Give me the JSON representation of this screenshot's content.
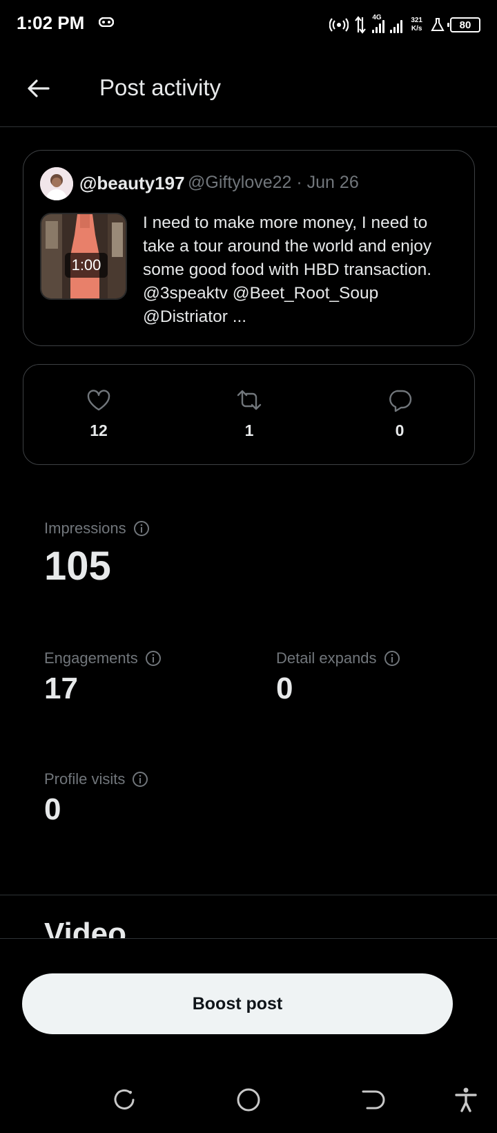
{
  "status_bar": {
    "time": "1:02 PM",
    "network_type": "4G",
    "speed_value": "321",
    "speed_unit": "K/s",
    "battery": "80"
  },
  "header": {
    "title": "Post activity",
    "back_icon": "arrow-left-icon"
  },
  "post": {
    "display_name": "@beauty197",
    "handle_date": "@Giftylove22 · Jun 26",
    "video_duration": "1:00",
    "text": "I need to make more money, I need to take a tour around the world and enjoy some good food with HBD transaction. @3speaktv  @Beet_Root_Soup @Distriator ..."
  },
  "engagement": {
    "likes": "12",
    "reposts": "1",
    "replies": "0"
  },
  "metrics": {
    "impressions": {
      "label": "Impressions",
      "value": "105"
    },
    "engagements": {
      "label": "Engagements",
      "value": "17"
    },
    "detail_expands": {
      "label": "Detail expands",
      "value": "0"
    },
    "profile_visits": {
      "label": "Profile visits",
      "value": "0"
    }
  },
  "section": {
    "title": "Video"
  },
  "boost": {
    "label": "Boost post"
  },
  "colors": {
    "background": "#000000",
    "text_primary": "#e7e9ea",
    "text_secondary": "#71767b",
    "border": "#3e4144",
    "button_bg": "#eff3f4"
  }
}
